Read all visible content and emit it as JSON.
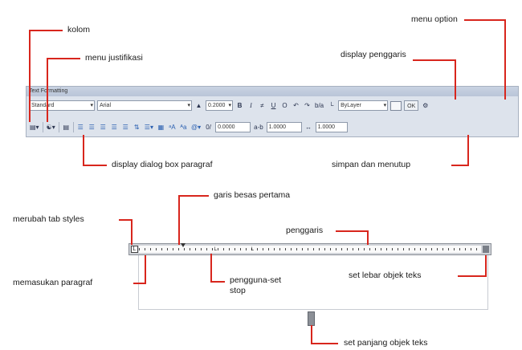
{
  "labels": {
    "kolom": "kolom",
    "menu_justifikasi": "menu justifikasi",
    "menu_option": "menu option",
    "display_penggaris": "display penggaris",
    "display_dialog_box_paragraf": "display dialog box paragraf",
    "simpan_dan_menutup": "simpan dan menutup",
    "garis_besas_pertama": "garis besas pertama",
    "merubah_tab_styles": "merubah tab styles",
    "penggaris": "penggaris",
    "memasukan_paragraf": "memasukan paragraf",
    "pengguna_set_stop": "pengguna-set stop",
    "set_lebar_objek_teks": "set lebar objek teks",
    "set_panjang_objek_teks": "set panjang objek teks"
  },
  "toolbar": {
    "title": "Text Formatting",
    "style_select": "Standard",
    "font_select": "Arial",
    "height_value": "0.2000",
    "bold": "B",
    "italic": "I",
    "underline": "U",
    "overline": "O",
    "undo": "↶",
    "redo": "↷",
    "stack": "b/a",
    "color_select": "ByLayer",
    "ok": "OK",
    "options": "⚙",
    "oblique_value": "0.0000",
    "tracking_value": "1.0000",
    "width_value": "1.0000"
  },
  "colors": {
    "annotation_line": "#d8261d",
    "toolbar_bg": "#dde3ec"
  }
}
